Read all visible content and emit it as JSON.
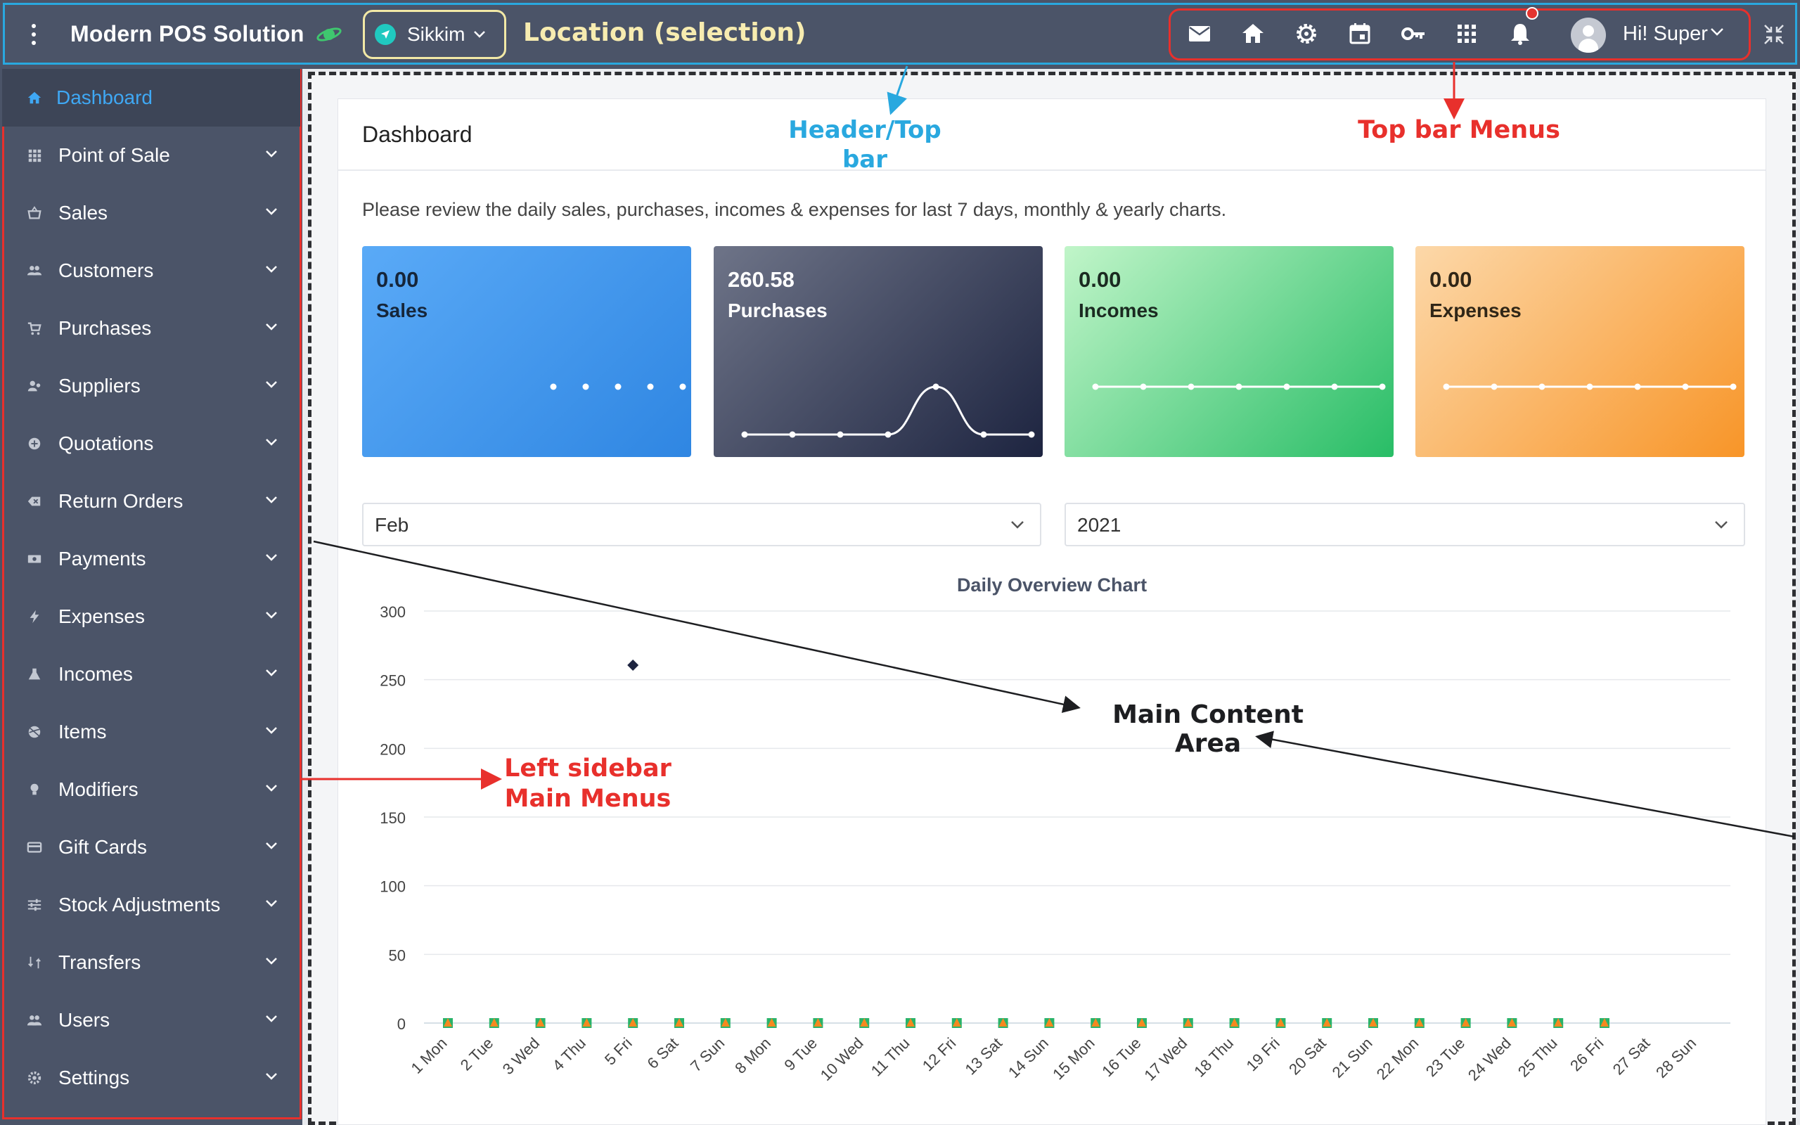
{
  "topbar": {
    "brand": "Modern POS Solution",
    "location": "Sikkim",
    "user_greeting": "Hi! Super",
    "icons": [
      "mail-icon",
      "home-icon",
      "gear-icon",
      "calendar-icon",
      "key-icon",
      "apps-grid-icon",
      "bell-icon"
    ]
  },
  "annotations": {
    "location": "Location (selection)",
    "header": "Header/Top bar",
    "topbar_menus": "Top bar Menus",
    "sidebar": "Left sidebar Main Menus",
    "main": "Main Content Area"
  },
  "sidebar": {
    "items": [
      {
        "label": "Dashboard",
        "icon": "home-icon",
        "active": true
      },
      {
        "label": "Point of Sale",
        "icon": "grid-icon"
      },
      {
        "label": "Sales",
        "icon": "basket-icon"
      },
      {
        "label": "Customers",
        "icon": "customers-icon"
      },
      {
        "label": "Purchases",
        "icon": "cart-icon"
      },
      {
        "label": "Suppliers",
        "icon": "suppliers-icon"
      },
      {
        "label": "Quotations",
        "icon": "quotation-icon"
      },
      {
        "label": "Return Orders",
        "icon": "backspace-icon"
      },
      {
        "label": "Payments",
        "icon": "money-icon"
      },
      {
        "label": "Expenses",
        "icon": "bolt-icon"
      },
      {
        "label": "Incomes",
        "icon": "flask-icon"
      },
      {
        "label": "Items",
        "icon": "ball-icon"
      },
      {
        "label": "Modifiers",
        "icon": "bulb-icon"
      },
      {
        "label": "Gift Cards",
        "icon": "card-icon"
      },
      {
        "label": "Stock Adjustments",
        "icon": "sliders-icon"
      },
      {
        "label": "Transfers",
        "icon": "transfer-icon"
      },
      {
        "label": "Users",
        "icon": "users-icon"
      },
      {
        "label": "Settings",
        "icon": "settings-icon"
      }
    ]
  },
  "main": {
    "title": "Dashboard",
    "intro": "Please review the daily sales, purchases, incomes & expenses for last 7 days, monthly & yearly charts.",
    "stats": {
      "sales": {
        "value": "0.00",
        "label": "Sales",
        "series": [
          0,
          0,
          0,
          0,
          0,
          0,
          0
        ]
      },
      "purchases": {
        "value": "260.58",
        "label": "Purchases",
        "series": [
          0,
          0,
          0,
          0,
          260.58,
          0,
          0
        ]
      },
      "incomes": {
        "value": "0.00",
        "label": "Incomes",
        "series": [
          0,
          0,
          0,
          0,
          0,
          0,
          0
        ]
      },
      "expenses": {
        "value": "0.00",
        "label": "Expenses",
        "series": [
          0,
          0,
          0,
          0,
          0,
          0,
          0
        ]
      }
    },
    "month_select": "Feb",
    "year_select": "2021"
  },
  "chart_data": {
    "type": "scatter",
    "title": "Daily Overview Chart",
    "xlabel": "",
    "ylabel": "",
    "ylim": [
      0,
      300
    ],
    "yticks": [
      0,
      50,
      100,
      150,
      200,
      250,
      300
    ],
    "categories": [
      "1 Mon",
      "2 Tue",
      "3 Wed",
      "4 Thu",
      "5 Fri",
      "6 Sat",
      "7 Sun",
      "8 Mon",
      "9 Tue",
      "10 Wed",
      "11 Thu",
      "12 Fri",
      "13 Sat",
      "14 Sun",
      "15 Mon",
      "16 Tue",
      "17 Wed",
      "18 Thu",
      "19 Fri",
      "20 Sat",
      "21 Sun",
      "22 Mon",
      "23 Tue",
      "24 Wed",
      "25 Thu",
      "26 Fri",
      "27 Sat",
      "28 Sun"
    ],
    "series": [
      {
        "values": [
          0,
          0,
          0,
          0,
          0,
          0,
          0,
          0,
          0,
          0,
          0,
          0,
          0,
          0,
          0,
          0,
          0,
          0,
          0,
          0,
          0,
          0,
          0,
          0,
          0,
          0
        ],
        "color": "#29b36a",
        "marker": "square"
      },
      {
        "values": [
          0,
          0,
          0,
          0,
          260.58,
          0,
          0,
          0,
          0,
          0,
          0,
          0,
          0,
          0,
          0,
          0,
          0,
          0,
          0,
          0,
          0,
          0,
          0,
          0,
          0,
          0
        ],
        "color": "#1d2440",
        "marker": "diamond"
      },
      {
        "values": [
          0,
          0,
          0,
          0,
          0,
          0,
          0,
          0,
          0,
          0,
          0,
          0,
          0,
          0,
          0,
          0,
          0,
          0,
          0,
          0,
          0,
          0,
          0,
          0,
          0,
          0
        ],
        "color": "#f5891f",
        "marker": "triangle"
      }
    ],
    "grid": true
  }
}
